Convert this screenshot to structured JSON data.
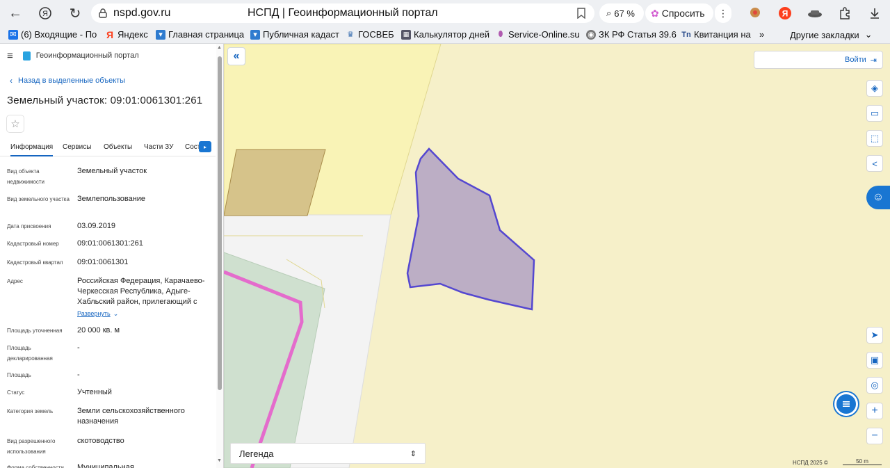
{
  "browser": {
    "url": "nspd.gov.ru",
    "tab_title": "НСПД | Геоинформационный портал",
    "zoom": "67 %",
    "ask_label": "Спросить"
  },
  "bookmarks": [
    {
      "label": "(6) Входящие - По"
    },
    {
      "label": "Яндекс"
    },
    {
      "label": "Главная страница"
    },
    {
      "label": "Публичная кадаст"
    },
    {
      "label": "ГОСВЕБ"
    },
    {
      "label": "Калькулятор дней"
    },
    {
      "label": "Service-Online.su"
    },
    {
      "label": "ЗК РФ Статья 39.6"
    },
    {
      "label": "Квитанция на"
    }
  ],
  "bookmarks_more": "»",
  "bookmarks_other": "Другие закладки",
  "panel": {
    "app_name": "Геоинформационный портал",
    "back_label": "Назад в выделенные объекты",
    "object_title": "Земельный участок: 09:01:0061301:261",
    "tabs": [
      "Информация",
      "Сервисы",
      "Объекты",
      "Части ЗУ",
      "Сост"
    ],
    "rows": [
      {
        "key": "Вид объекта недвижимости",
        "value": "Земельный участок"
      },
      {
        "key": "Вид земельного участка",
        "value": "Землепользование"
      },
      {
        "key": "Дата присвоения",
        "value": "03.09.2019"
      },
      {
        "key": "Кадастровый номер",
        "value": "09:01:0061301:261"
      },
      {
        "key": "Кадастровый квартал",
        "value": "09:01:0061301"
      },
      {
        "key": "Адрес",
        "value": "Российская Федерация, Карачаево-Черкесская Республика, Адыге-Хабльский район, прилегающий с"
      },
      {
        "key": "Площадь уточненная",
        "value": "20 000 кв. м"
      },
      {
        "key": "Площадь декларированная",
        "value": "-"
      },
      {
        "key": "Площадь",
        "value": "-"
      },
      {
        "key": "Статус",
        "value": "Учтенный"
      },
      {
        "key": "Категория земель",
        "value": "Земли сельскохозяйственного назначения"
      },
      {
        "key": "Вид разрешенного использования",
        "value": "скотоводство"
      },
      {
        "key": "Форма собственности",
        "value": "Муниципальная"
      }
    ],
    "expand_label": "Развернуть"
  },
  "map": {
    "login_label": "Войти",
    "legend_label": "Легенда",
    "attribution": "НСПД 2025 ©",
    "scale_label": "50 m"
  },
  "colors": {
    "accent": "#1565c0",
    "parcel_fill": "#bcaec5",
    "parcel_stroke": "#5548d0",
    "map_bg": "#f6f0c9"
  }
}
